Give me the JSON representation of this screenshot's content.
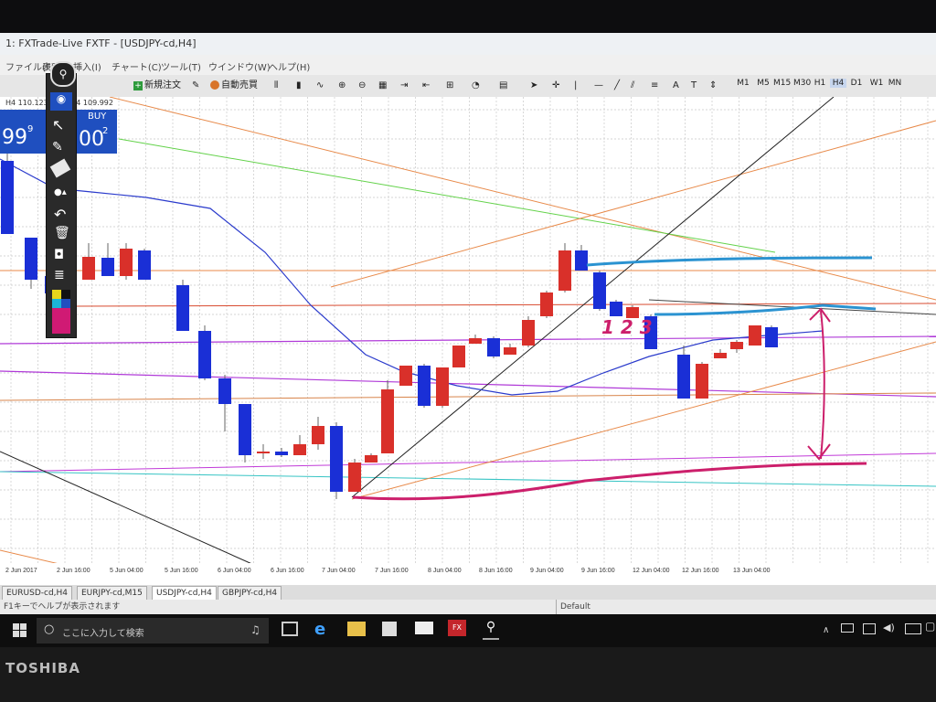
{
  "window": {
    "title": "1: FXTrade-Live FXTF - [USDJPY-cd,H4]"
  },
  "menu": [
    "ファイル(F)",
    "表示(V)",
    "挿入(I)",
    "チャート(C)",
    "ツール(T)",
    "ウインドウ(W)",
    "ヘルプ(H)"
  ],
  "toolbar": {
    "new_order": "新規注文",
    "auto_trade": "自動売買"
  },
  "timeframes": [
    "M1",
    "M5",
    "M15",
    "M30",
    "H1",
    "H4",
    "D1",
    "W1",
    "MN"
  ],
  "chart_header": {
    "symbol_line": "H4  110.123 109.984 109.992"
  },
  "one_click": {
    "buy_label": "BUY",
    "sell_price": "99",
    "sell_sup": "9",
    "buy_price": "00",
    "buy_sup": "2"
  },
  "annotation": {
    "text": "1 2 3"
  },
  "time_axis": [
    "2 Jun 2017",
    "2 Jun 16:00",
    "5 Jun 04:00",
    "5 Jun 16:00",
    "6 Jun 04:00",
    "6 Jun 16:00",
    "7 Jun 04:00",
    "7 Jun 16:00",
    "8 Jun 04:00",
    "8 Jun 16:00",
    "9 Jun 04:00",
    "9 Jun 16:00",
    "12 Jun 04:00",
    "12 Jun 16:00",
    "13 Jun 04:00"
  ],
  "tabs": [
    "EURUSD-cd,H4",
    "EURJPY-cd,M15",
    "USDJPY-cd,H4",
    "GBPJPY-cd,H4"
  ],
  "status": {
    "help": "F1キーでヘルプが表示されます",
    "profile": "Default"
  },
  "taskbar": {
    "search_placeholder": "ここに入力して検索"
  },
  "bezel": {
    "brand": "TOSHIBA"
  },
  "colors": {
    "bull": "#d9302a",
    "bear": "#1a2fd6",
    "pink_annotation": "#cc1f6b",
    "blue_annotation": "#2b93d1"
  }
}
